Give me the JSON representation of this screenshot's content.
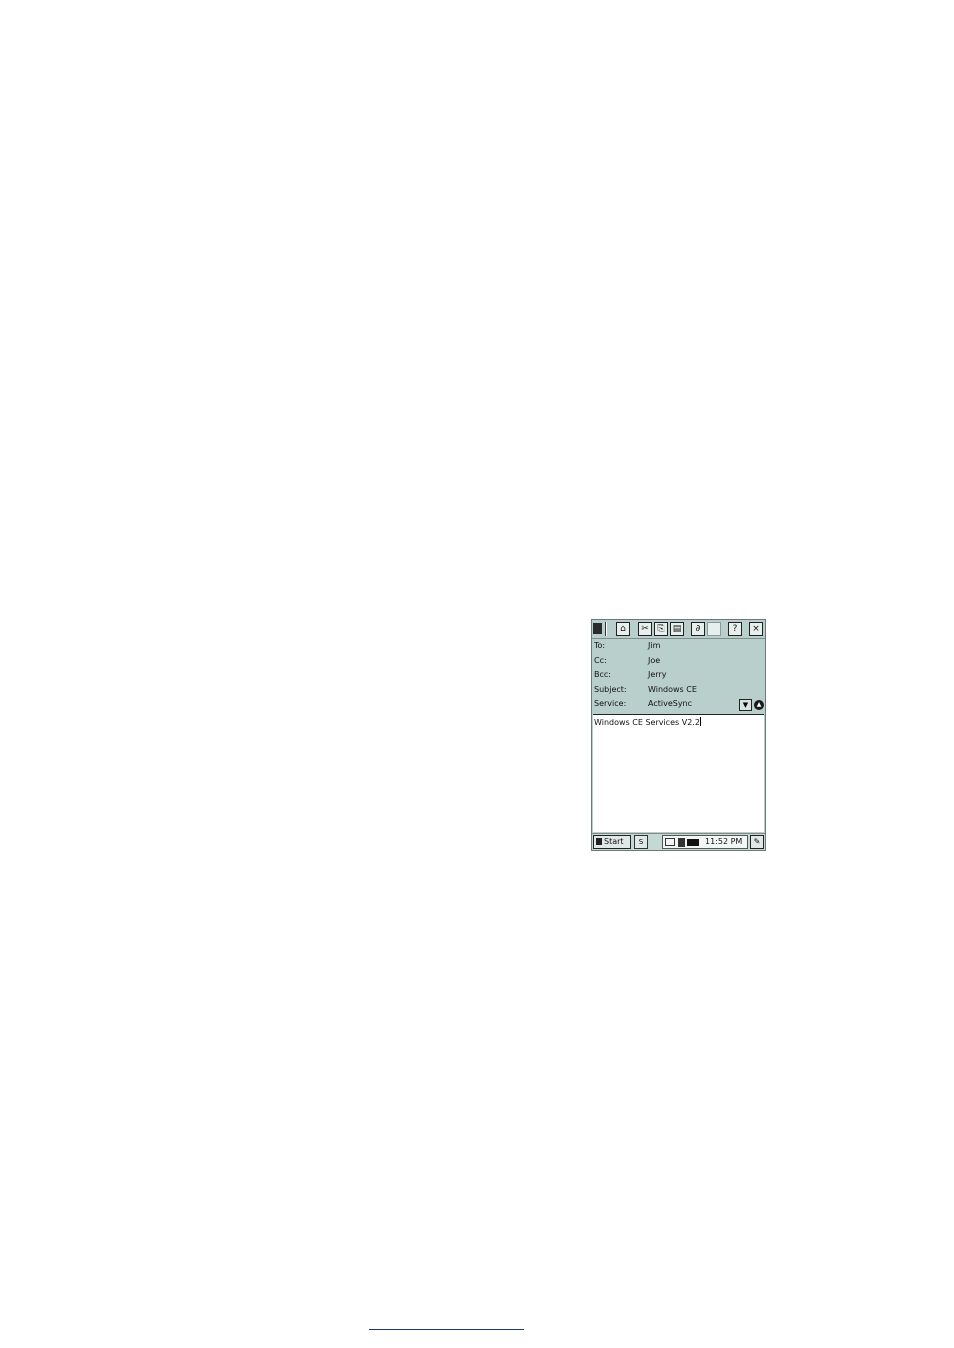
{
  "toolbar": {
    "buttons": [
      {
        "icon": "send-icon",
        "glyph": "⌂"
      },
      {
        "icon": "cut-icon",
        "glyph": "✂"
      },
      {
        "icon": "copy-icon",
        "glyph": "⎘"
      },
      {
        "icon": "paste-icon",
        "glyph": "▤"
      },
      {
        "icon": "attach-icon",
        "glyph": "∂"
      },
      {
        "icon": "blank-icon",
        "glyph": ""
      },
      {
        "icon": "help-icon",
        "glyph": "?"
      },
      {
        "icon": "close-icon",
        "glyph": "×"
      }
    ]
  },
  "message": {
    "to_label": "To:",
    "to_value": "Jim",
    "cc_label": "Cc:",
    "cc_value": "Joe",
    "bcc_label": "Bcc:",
    "bcc_value": "Jerry",
    "subject_label": "Subject:",
    "subject_value": "Windows CE",
    "service_label": "Service:",
    "service_value": "ActiveSync",
    "body_text": "Windows CE Services V2.2"
  },
  "taskbar": {
    "start_label": "Start",
    "task_label": "S",
    "clock": "11:52 PM"
  }
}
